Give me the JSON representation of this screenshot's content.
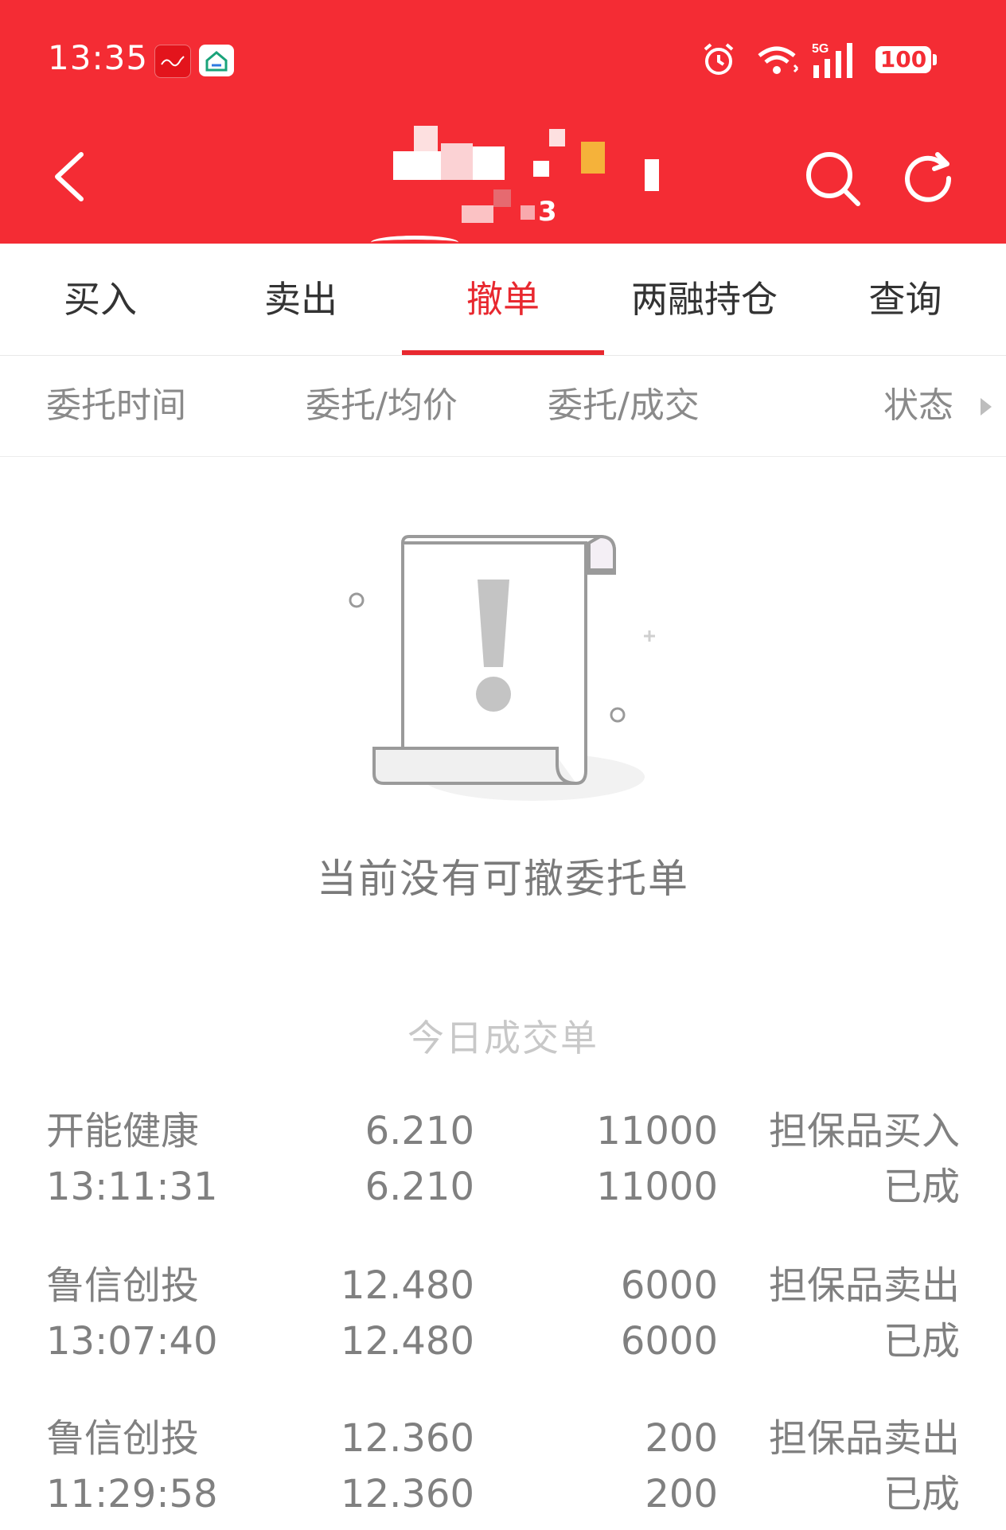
{
  "status_bar": {
    "time": "13:35",
    "battery": "100",
    "network": "5G",
    "icons": [
      "app-icon-red",
      "app-icon-home",
      "alarm-icon",
      "wifi-icon",
      "signal-icon",
      "battery-icon"
    ]
  },
  "nav": {
    "back_icon": "chevron-left-icon",
    "search_icon": "search-icon",
    "refresh_icon": "refresh-icon",
    "title_digit": "3"
  },
  "tabs": [
    {
      "label": "买入"
    },
    {
      "label": "卖出"
    },
    {
      "label": "撤单",
      "active": true
    },
    {
      "label": "两融持仓"
    },
    {
      "label": "查询"
    }
  ],
  "columns": {
    "time": "委托时间",
    "price": "委托/均价",
    "qty": "委托/成交",
    "status": "状态"
  },
  "empty_state": {
    "message": "当前没有可撤委托单"
  },
  "today_section": {
    "title": "今日成交单",
    "rows": [
      {
        "name": "开能健康",
        "time": "13:11:31",
        "price": "6.210",
        "avg_price": "6.210",
        "qty": "11000",
        "filled": "11000",
        "type": "担保品买入",
        "status": "已成"
      },
      {
        "name": "鲁信创投",
        "time": "13:07:40",
        "price": "12.480",
        "avg_price": "12.480",
        "qty": "6000",
        "filled": "6000",
        "type": "担保品卖出",
        "status": "已成"
      },
      {
        "name": "鲁信创投",
        "time": "11:29:58",
        "price": "12.360",
        "avg_price": "12.360",
        "qty": "200",
        "filled": "200",
        "type": "担保品卖出",
        "status": "已成"
      }
    ]
  },
  "colors": {
    "brand_red": "#f42c34",
    "active_tab": "#e8282f",
    "text_muted": "#808080"
  }
}
